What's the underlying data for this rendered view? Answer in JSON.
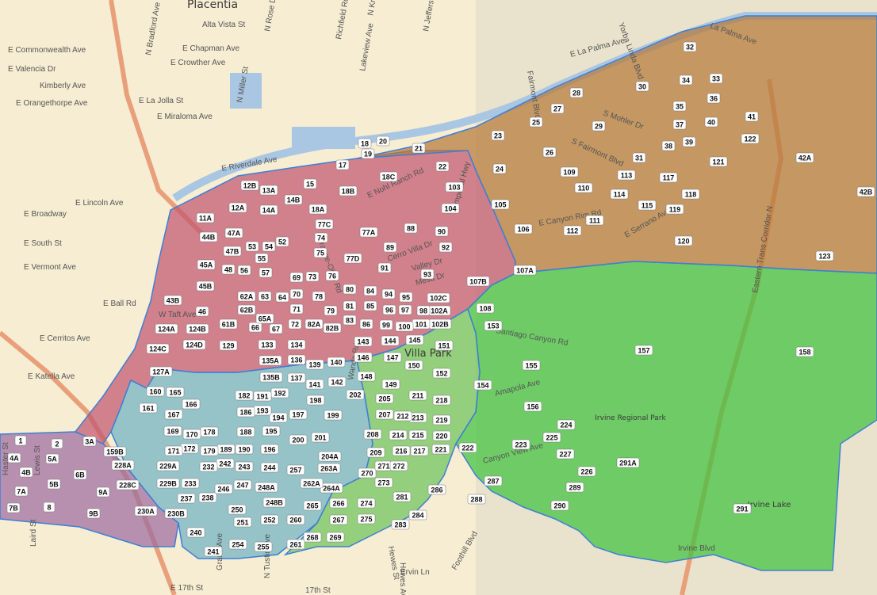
{
  "map": {
    "places": [
      {
        "name": "Placentia",
        "size": "large"
      },
      {
        "name": "Villa Park",
        "size": "large"
      },
      {
        "name": "Irvine Regional Park",
        "size": "small"
      },
      {
        "name": "Irvine Lake",
        "size": "small"
      }
    ],
    "streets": [
      "E Commonwealth Ave",
      "E Chapman Ave",
      "E Crowther Ave",
      "E Valencia Dr",
      "Kimberly Ave",
      "E Orangethorpe Ave",
      "E La Jolla St",
      "E Miraloma Ave",
      "E Riverdale Ave",
      "E Lincoln Ave",
      "E Broadway",
      "E South St",
      "E Vermont Ave",
      "E Ball Rd",
      "E Cerritos Ave",
      "E Katella Ave",
      "W Taft Ave",
      "E La Palma Ave",
      "La Palma Ave",
      "Fairmont Blvd",
      "S Fairmont Blvd",
      "E Nohl Ranch Rd",
      "E Canyon Rim Rd",
      "E Serrano Ave",
      "Santiago Canyon Rd",
      "Amapola Ave",
      "Canyon View Ave",
      "Foothill Blvd",
      "E 17th St",
      "17th St",
      "Irvine Blvd",
      "Eastern Trans Corridor N",
      "S Imperial Hwy",
      "Cerro Villa Dr",
      "Mesa Dr",
      "Valley Dr",
      "Hewes Ave",
      "Ervin Ln",
      "Grand Ave",
      "N Tustin Ave",
      "Alta Vista St",
      "N Bradford Ave",
      "N Rose Dr",
      "Richfield Rd",
      "Lakeview Ave",
      "N Kraemer Blvd",
      "N Miller St",
      "Orange-Olive Rd",
      "Hewes St",
      "Haster St",
      "Lewis St",
      "Laird St",
      "Yorba Linda Blvd",
      "N Jefferson St",
      "S Mohler Dr",
      "Wanda Rd"
    ],
    "regions": [
      {
        "name": "west",
        "color": "#9c6ca0"
      },
      {
        "name": "north",
        "color": "#c0586f"
      },
      {
        "name": "central",
        "color": "#6fb3c4"
      },
      {
        "name": "south",
        "color": "#6cc35a"
      },
      {
        "name": "northeast",
        "color": "#b57a3a"
      },
      {
        "name": "east",
        "color": "#3ec23e"
      }
    ],
    "zones": [
      "32",
      "30",
      "34",
      "33",
      "35",
      "36",
      "37",
      "40",
      "41",
      "38",
      "39",
      "122",
      "42A",
      "42B",
      "29",
      "31",
      "28",
      "27",
      "25",
      "26",
      "23",
      "24",
      "22",
      "21",
      "20",
      "19",
      "18",
      "17",
      "109",
      "110",
      "113",
      "117",
      "121",
      "114",
      "115",
      "118",
      "119",
      "111",
      "112",
      "105",
      "106",
      "104",
      "103",
      "120",
      "123",
      "107A",
      "107B",
      "108",
      "157",
      "158",
      "155",
      "156",
      "153",
      "154",
      "152",
      "150",
      "151",
      "149",
      "218",
      "219",
      "220",
      "221",
      "222",
      "223",
      "224",
      "225",
      "227",
      "226",
      "228",
      "289",
      "290",
      "291",
      "291A",
      "287",
      "288",
      "286",
      "284",
      "283",
      "281",
      "273",
      "274",
      "275",
      "276",
      "277",
      "278",
      "279",
      "280",
      "285",
      "282",
      "270",
      "271",
      "272",
      "266",
      "267",
      "268",
      "269",
      "265",
      "264A",
      "264B",
      "263A",
      "263B",
      "262B",
      "262A",
      "261",
      "260",
      "259",
      "258",
      "257",
      "256",
      "255",
      "254",
      "253",
      "252",
      "251",
      "250",
      "249",
      "248A",
      "248B",
      "247",
      "246",
      "245",
      "244",
      "243",
      "242",
      "241",
      "240",
      "239",
      "238",
      "237",
      "236",
      "235",
      "234",
      "233",
      "232",
      "231",
      "230A",
      "230B",
      "229A",
      "229B",
      "228A",
      "228B",
      "228C",
      "227",
      "226",
      "225",
      "224",
      "223",
      "222",
      "221",
      "220",
      "219",
      "218",
      "217",
      "216",
      "215",
      "214",
      "213",
      "212",
      "211",
      "210",
      "209",
      "208",
      "207",
      "206",
      "205",
      "204A",
      "204B",
      "203",
      "202",
      "201",
      "200",
      "199",
      "198",
      "197",
      "196",
      "195",
      "194",
      "193",
      "192",
      "191",
      "190",
      "189",
      "188",
      "187",
      "186",
      "185",
      "184",
      "183",
      "182",
      "181",
      "180",
      "179",
      "178",
      "177",
      "176",
      "175",
      "174",
      "173",
      "172",
      "171",
      "170",
      "169",
      "168",
      "167",
      "166",
      "165",
      "164A",
      "164B",
      "163A",
      "163B",
      "162A",
      "162B",
      "161",
      "160",
      "159A",
      "159B",
      "158",
      "148",
      "147",
      "146",
      "145",
      "144",
      "143",
      "142",
      "141",
      "140",
      "139",
      "138A",
      "138B",
      "137",
      "136",
      "135A",
      "135B",
      "134",
      "133",
      "132A",
      "132B",
      "131A",
      "131B",
      "130",
      "129",
      "128",
      "127A",
      "127B",
      "126",
      "125",
      "124A",
      "124B",
      "124C",
      "124D",
      "102A",
      "102B",
      "102C",
      "101",
      "100",
      "99",
      "98",
      "97",
      "96",
      "95",
      "94",
      "93",
      "92",
      "91",
      "90",
      "89",
      "88",
      "87A",
      "87B",
      "86",
      "85",
      "84",
      "83",
      "82A",
      "82B",
      "81",
      "80",
      "79",
      "78",
      "77A",
      "77B",
      "77C",
      "77D",
      "76",
      "75",
      "74",
      "73",
      "72",
      "71",
      "70",
      "69",
      "68",
      "67",
      "66",
      "65A",
      "65B",
      "64",
      "63",
      "62A",
      "62B",
      "61A",
      "61B",
      "60A",
      "60B",
      "59",
      "58",
      "57",
      "56",
      "55",
      "54",
      "53",
      "52",
      "51A",
      "51B",
      "50A",
      "50B",
      "49",
      "48",
      "47A",
      "47B",
      "46",
      "45A",
      "45B",
      "44A",
      "44B",
      "43A",
      "43B",
      "18A",
      "18B",
      "18C",
      "16",
      "15",
      "14A",
      "14B",
      "13A",
      "13B",
      "12A",
      "12B",
      "11A",
      "11B",
      "10",
      "9A",
      "9B",
      "8",
      "7A",
      "7B",
      "6A",
      "6B",
      "5A",
      "5B",
      "4A",
      "4B",
      "3A",
      "3B",
      "2",
      "1"
    ]
  }
}
